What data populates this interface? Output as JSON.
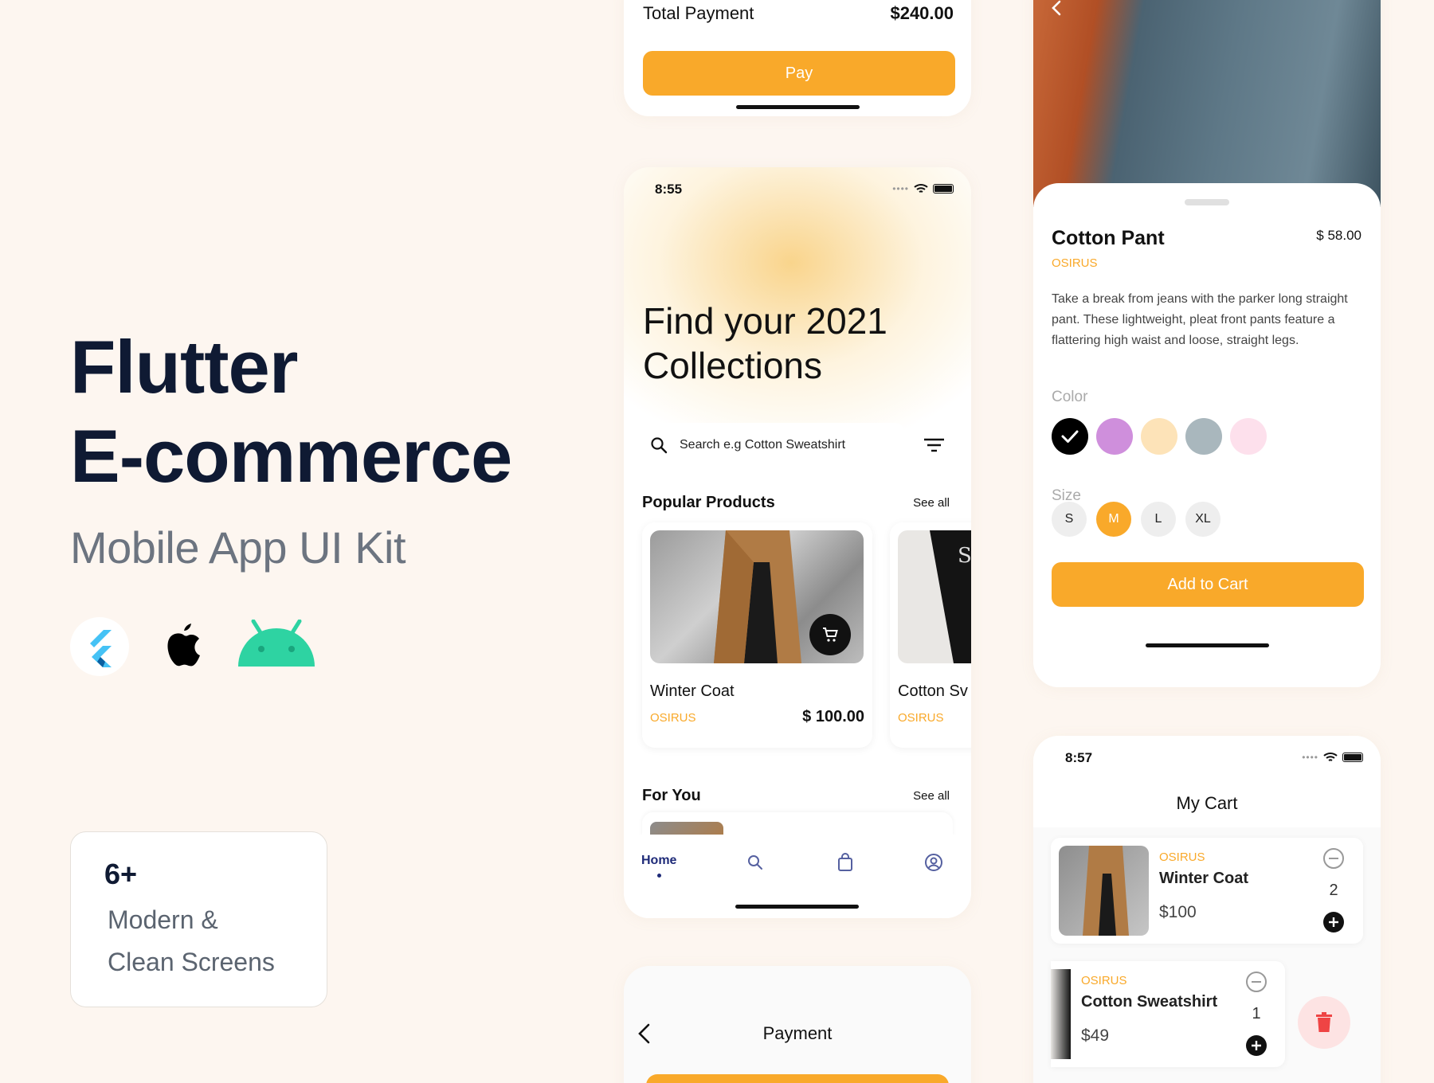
{
  "hero": {
    "title_line1": "Flutter",
    "title_line2": "E-commerce",
    "subtitle": "Mobile App UI Kit",
    "platform_icons": [
      "flutter-icon",
      "apple-icon",
      "android-icon"
    ]
  },
  "stat_card": {
    "count": "6+",
    "line1": "Modern &",
    "line2": "Clean Screens"
  },
  "checkout_top": {
    "total_label": "Total Payment",
    "total_value": "$240.00",
    "pay_label": "Pay"
  },
  "home_screen": {
    "time": "8:55",
    "headline_line1": "Find your 2021",
    "headline_line2": "Collections",
    "search_placeholder": "Search e.g Cotton Sweatshirt",
    "popular_title": "Popular Products",
    "popular_see_all": "See all",
    "products": [
      {
        "name": "Winter Coat",
        "brand": "OSIRUS",
        "price": "$ 100.00"
      },
      {
        "name": "Cotton Sv",
        "brand": "OSIRUS"
      }
    ],
    "for_you_title": "For You",
    "for_you_see_all": "See all",
    "nav": {
      "home_label": "Home"
    }
  },
  "payment_screen": {
    "title": "Payment"
  },
  "detail_screen": {
    "name": "Cotton Pant",
    "price": "$ 58.00",
    "brand": "OSIRUS",
    "description": "Take a break from jeans with the parker long straight pant. These lightweight, pleat front pants feature a flattering high waist and loose, straight legs.",
    "color_label": "Color",
    "colors": [
      "#000000",
      "#cf8fdc",
      "#fde3b8",
      "#a9b7bd",
      "#fde0ec"
    ],
    "size_label": "Size",
    "sizes": [
      "S",
      "M",
      "L",
      "XL"
    ],
    "selected_size": "M",
    "add_to_cart": "Add to Cart"
  },
  "cart_screen": {
    "time": "8:57",
    "title": "My Cart",
    "items": [
      {
        "brand": "OSIRUS",
        "name": "Winter Coat",
        "price": "$100",
        "qty": "2"
      },
      {
        "brand": "OSIRUS",
        "name": "Cotton Sweatshirt",
        "price": "$49",
        "qty": "1"
      }
    ]
  },
  "colors": {
    "accent": "#f9a92a",
    "navy": "#0f1a33",
    "background": "#fdf6f0",
    "delete_bg": "#fde3e3",
    "delete_icon": "#ef4444"
  }
}
